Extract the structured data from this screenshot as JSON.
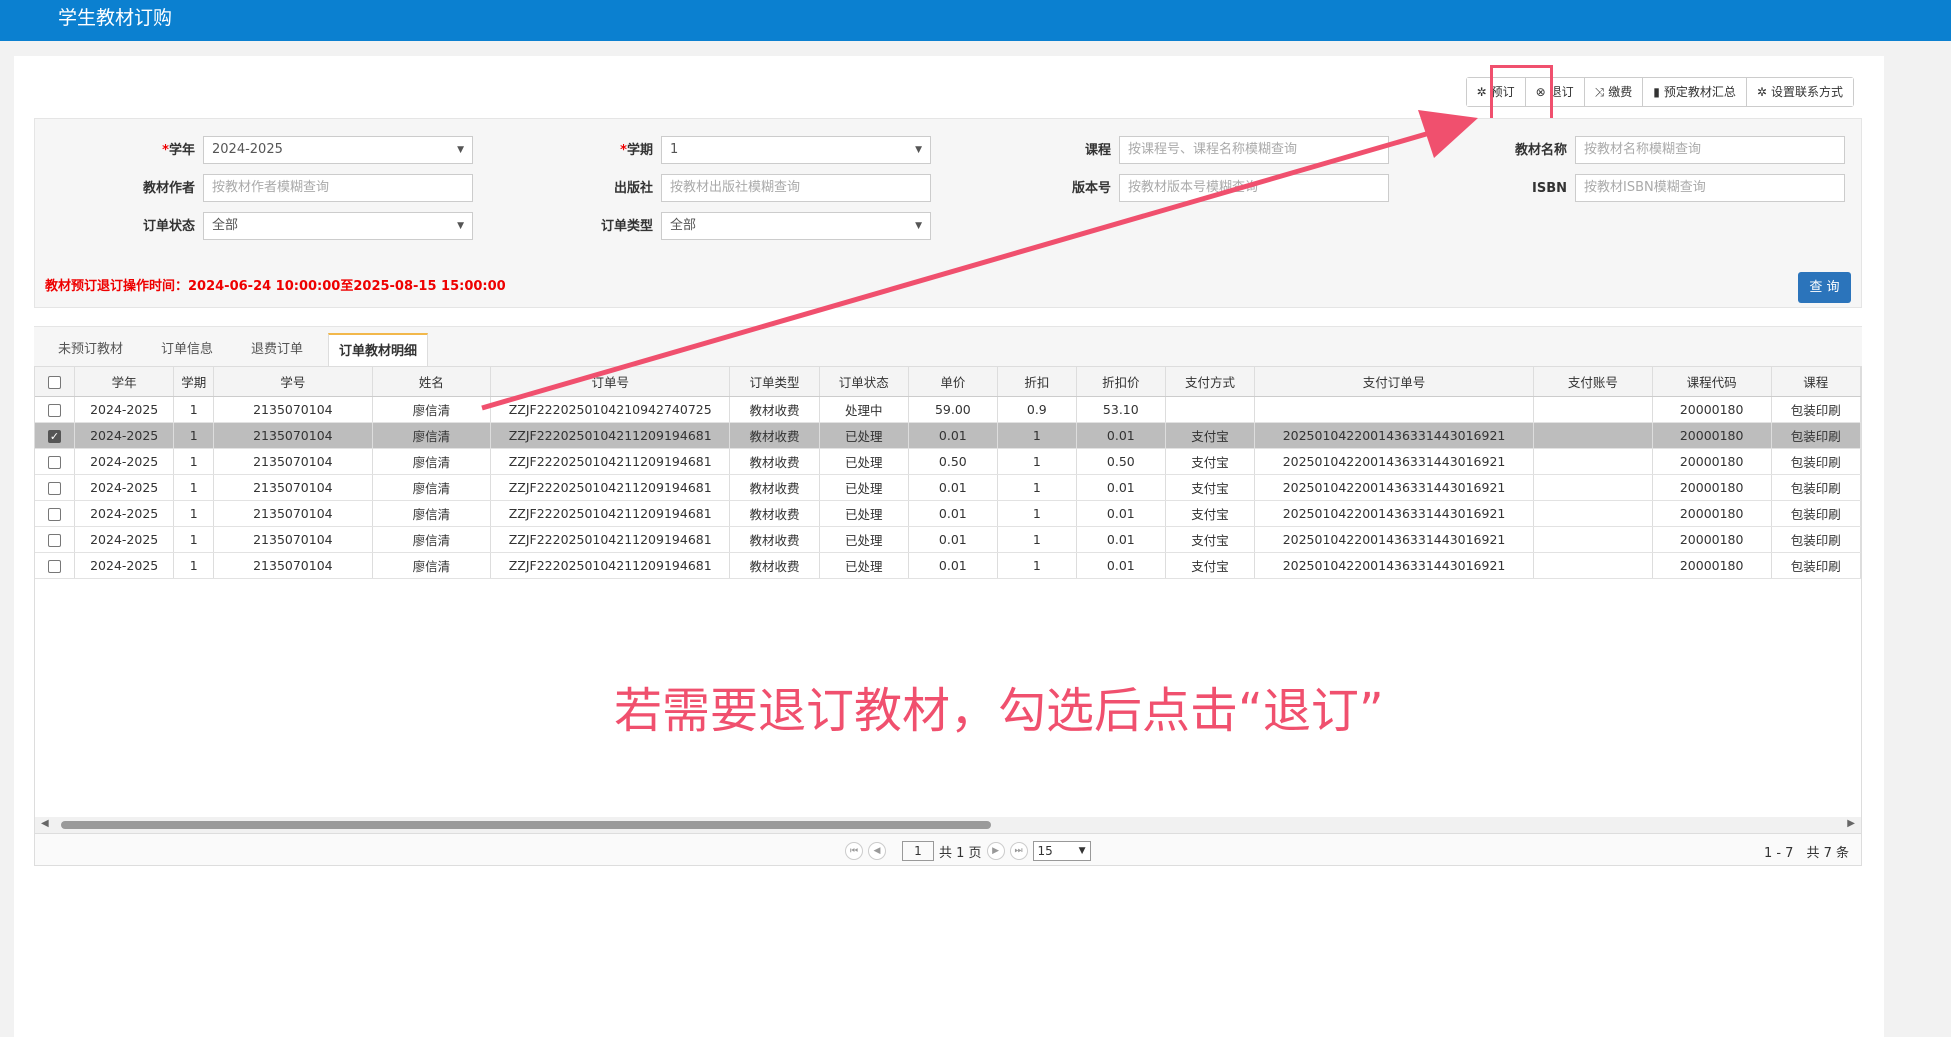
{
  "app": {
    "title": "学生教材订购"
  },
  "toolbar": {
    "buttons": [
      {
        "label": "预订",
        "icon": "gear-icon",
        "glyph": "✲"
      },
      {
        "label": "退订",
        "icon": "cancel-circle-icon",
        "glyph": "⊗"
      },
      {
        "label": "缴费",
        "icon": "shuffle-icon",
        "glyph": "⤨"
      },
      {
        "label": "预定教材汇总",
        "icon": "bar-chart-icon",
        "glyph": "▮"
      },
      {
        "label": "设置联系方式",
        "icon": "gear-icon",
        "glyph": "✲"
      }
    ]
  },
  "filters": {
    "school_year": {
      "label": "学年",
      "required_mark": "*",
      "value": "2024-2025"
    },
    "term": {
      "label": "学期",
      "required_mark": "*",
      "value": "1"
    },
    "course": {
      "label": "课程",
      "placeholder": "按课程号、课程名称模糊查询"
    },
    "book_name": {
      "label": "教材名称",
      "placeholder": "按教材名称模糊查询"
    },
    "author": {
      "label": "教材作者",
      "placeholder": "按教材作者模糊查询"
    },
    "publisher": {
      "label": "出版社",
      "placeholder": "按教材出版社模糊查询"
    },
    "edition": {
      "label": "版本号",
      "placeholder": "按教材版本号模糊查询"
    },
    "isbn": {
      "label": "ISBN",
      "placeholder": "按教材ISBN模糊查询"
    },
    "order_status": {
      "label": "订单状态",
      "value": "全部"
    },
    "order_type": {
      "label": "订单类型",
      "value": "全部"
    },
    "notice": "教材预订退订操作时间：2024-06-24 10:00:00至2025-08-15 15:00:00",
    "query_label": "查 询"
  },
  "tabs": [
    {
      "label": "未预订教材"
    },
    {
      "label": "订单信息"
    },
    {
      "label": "退费订单"
    },
    {
      "label": "订单教材明细",
      "active": true
    }
  ],
  "table": {
    "columns": [
      "学年",
      "学期",
      "学号",
      "姓名",
      "订单号",
      "订单类型",
      "订单状态",
      "单价",
      "折扣",
      "折扣价",
      "支付方式",
      "支付订单号",
      "支付账号",
      "课程代码",
      "课程"
    ],
    "rows": [
      {
        "checked": false,
        "cells": [
          "2024-2025",
          "1",
          "2135070104",
          "廖信清",
          "ZZJF2220250104210942740725",
          "教材收费",
          "处理中",
          "59.00",
          "0.9",
          "53.10",
          "",
          "",
          "",
          "20000180",
          "包装印刷"
        ]
      },
      {
        "checked": true,
        "cells": [
          "2024-2025",
          "1",
          "2135070104",
          "廖信清",
          "ZZJF2220250104211209194681",
          "教材收费",
          "已处理",
          "0.01",
          "1",
          "0.01",
          "支付宝",
          "2025010422001436331443016921",
          "",
          "20000180",
          "包装印刷"
        ]
      },
      {
        "checked": false,
        "cells": [
          "2024-2025",
          "1",
          "2135070104",
          "廖信清",
          "ZZJF2220250104211209194681",
          "教材收费",
          "已处理",
          "0.50",
          "1",
          "0.50",
          "支付宝",
          "2025010422001436331443016921",
          "",
          "20000180",
          "包装印刷"
        ]
      },
      {
        "checked": false,
        "cells": [
          "2024-2025",
          "1",
          "2135070104",
          "廖信清",
          "ZZJF2220250104211209194681",
          "教材收费",
          "已处理",
          "0.01",
          "1",
          "0.01",
          "支付宝",
          "2025010422001436331443016921",
          "",
          "20000180",
          "包装印刷"
        ]
      },
      {
        "checked": false,
        "cells": [
          "2024-2025",
          "1",
          "2135070104",
          "廖信清",
          "ZZJF2220250104211209194681",
          "教材收费",
          "已处理",
          "0.01",
          "1",
          "0.01",
          "支付宝",
          "2025010422001436331443016921",
          "",
          "20000180",
          "包装印刷"
        ]
      },
      {
        "checked": false,
        "cells": [
          "2024-2025",
          "1",
          "2135070104",
          "廖信清",
          "ZZJF2220250104211209194681",
          "教材收费",
          "已处理",
          "0.01",
          "1",
          "0.01",
          "支付宝",
          "2025010422001436331443016921",
          "",
          "20000180",
          "包装印刷"
        ]
      },
      {
        "checked": false,
        "cells": [
          "2024-2025",
          "1",
          "2135070104",
          "廖信清",
          "ZZJF2220250104211209194681",
          "教材收费",
          "已处理",
          "0.01",
          "1",
          "0.01",
          "支付宝",
          "2025010422001436331443016921",
          "",
          "20000180",
          "包装印刷"
        ]
      }
    ]
  },
  "pager": {
    "page": "1",
    "total_pages_text": "共 1 页",
    "page_size": "15",
    "info": "1 - 7　共 7 条"
  },
  "annotation": {
    "text": "若需要退订教材，勾选后点击“退订”",
    "color": "#f0506e"
  }
}
